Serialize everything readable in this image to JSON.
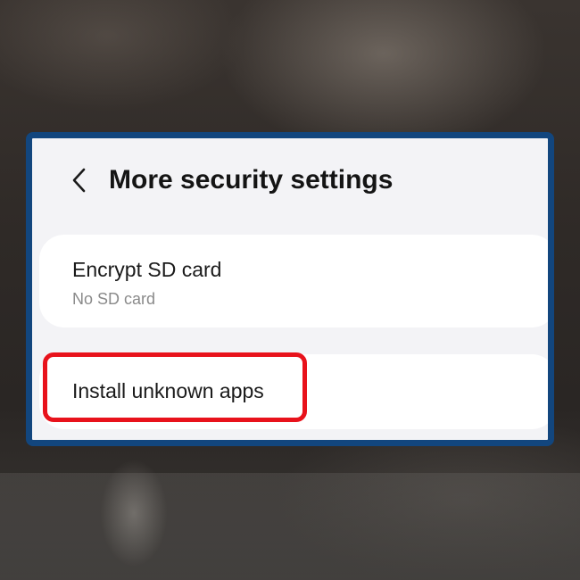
{
  "header": {
    "back_icon": "chevron-left-icon",
    "title": "More security settings"
  },
  "items": [
    {
      "title": "Encrypt SD card",
      "subtitle": "No SD card"
    },
    {
      "title": "Install unknown apps",
      "highlighted": true
    }
  ],
  "colors": {
    "frame_border": "#12467e",
    "highlight": "#e8121b",
    "background": "#f3f3f6",
    "card": "#ffffff"
  }
}
